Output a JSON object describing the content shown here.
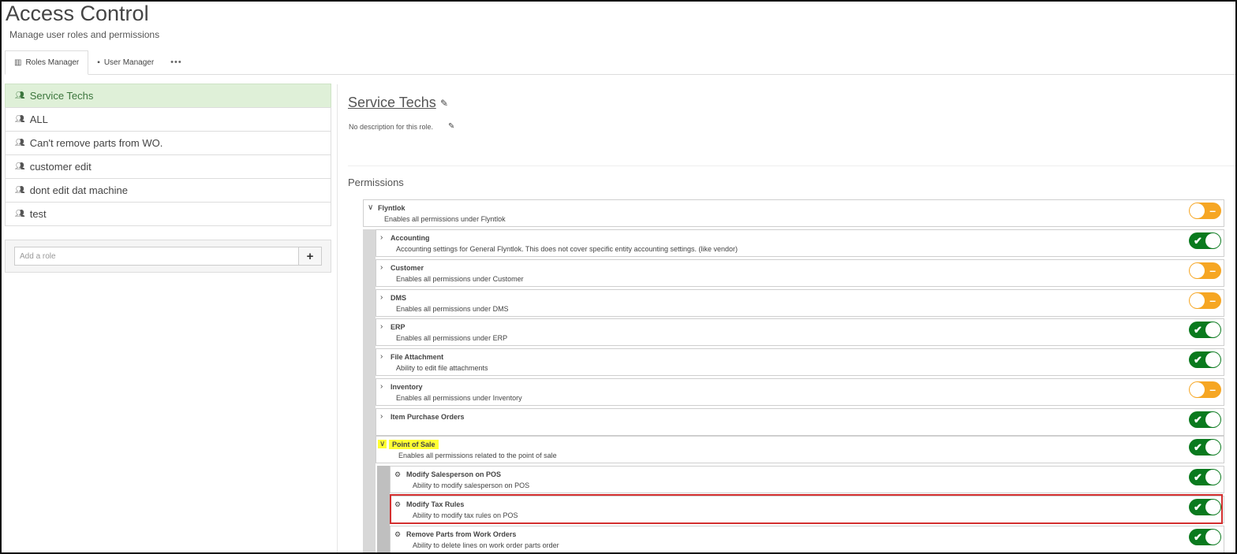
{
  "app": {
    "title": "Access Control",
    "subtitle": "Manage user roles and permissions"
  },
  "tabs": [
    {
      "label": "Roles Manager",
      "icon": "building-icon",
      "active": true
    },
    {
      "label": "User Manager",
      "icon": "address-book-icon",
      "active": false
    },
    {
      "label": "•••",
      "icon": "more-icon",
      "active": false
    }
  ],
  "roles": [
    {
      "label": "Service Techs",
      "active": true
    },
    {
      "label": "ALL"
    },
    {
      "label": "Can't remove parts from WO."
    },
    {
      "label": "customer edit"
    },
    {
      "label": "dont edit dat machine"
    },
    {
      "label": "test"
    }
  ],
  "add_role": {
    "placeholder": "Add a role",
    "button": "+"
  },
  "selected_role": {
    "name": "Service Techs",
    "description": "No description for this role."
  },
  "permissions_heading": "Permissions",
  "permissions": {
    "flyntlok": {
      "name": "Flyntlok",
      "desc": "Enables all permissions under Flyntlok",
      "state": "partial"
    },
    "accounting": {
      "name": "Accounting",
      "desc": "Accounting settings for General Flyntlok. This does not cover specific entity accounting settings. (like vendor)",
      "state": "on"
    },
    "customer": {
      "name": "Customer",
      "desc": "Enables all permissions under Customer",
      "state": "partial"
    },
    "dms": {
      "name": "DMS",
      "desc": "Enables all permissions under DMS",
      "state": "partial"
    },
    "erp": {
      "name": "ERP",
      "desc": "Enables all permissions under ERP",
      "state": "on"
    },
    "file_attachment": {
      "name": "File Attachment",
      "desc": "Ability to edit file attachments",
      "state": "on"
    },
    "inventory": {
      "name": "Inventory",
      "desc": "Enables all permissions under Inventory",
      "state": "partial"
    },
    "item_purchase_orders": {
      "name": "Item Purchase Orders",
      "desc": "",
      "state": "on"
    },
    "point_of_sale": {
      "name": "Point of Sale",
      "desc": "Enables all permissions related to the point of sale",
      "state": "on",
      "highlighted": true
    },
    "modify_salesperson": {
      "name": "Modify Salesperson on POS",
      "desc": "Ability to modify salesperson on POS",
      "state": "on"
    },
    "modify_tax_rules": {
      "name": "Modify Tax Rules",
      "desc": "Ability to modify tax rules on POS",
      "state": "on",
      "outlined": true
    },
    "remove_parts": {
      "name": "Remove Parts from Work Orders",
      "desc": "Ability to delete lines on work order parts order",
      "state": "on"
    }
  },
  "toggle_glyphs": {
    "on": "✔",
    "partial": "–"
  },
  "colors": {
    "on": "#0a7a1e",
    "partial": "#f6a623",
    "active_role_bg": "#dff0d8",
    "highlight": "#ffff33",
    "outline": "#d32f2f"
  }
}
